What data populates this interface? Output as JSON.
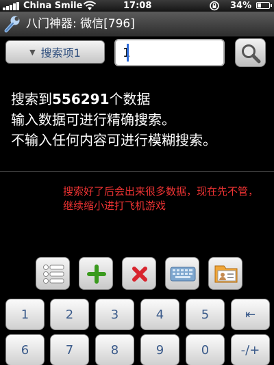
{
  "status_bar": {
    "carrier": "China Smile",
    "time": "17:08",
    "battery_percent": "34%",
    "battery_level": 0.34,
    "icons": [
      "signal-icon",
      "wifi-icon",
      "rotation-lock-icon",
      "battery-icon"
    ]
  },
  "title_bar": {
    "title": "八门神器: 微信[796]",
    "icon": "wrench-icon"
  },
  "search": {
    "type_button_label": "搜索项1",
    "input_value": "1",
    "search_icon": "search-icon"
  },
  "info": {
    "line1_prefix": "搜索到",
    "line1_count": "556291",
    "line1_suffix": "个数据",
    "line2": "输入数据可进行精确搜索。",
    "line3": "不输入任何内容可进行模糊搜索。"
  },
  "annotation": {
    "text": "搜索好了后会出来很多数据，现在先不管，继续缩小进打飞机游戏"
  },
  "toolbar": {
    "items": [
      {
        "name": "list-button",
        "icon": "list-icon"
      },
      {
        "name": "add-button",
        "icon": "plus-icon"
      },
      {
        "name": "delete-button",
        "icon": "close-icon"
      },
      {
        "name": "keyboard-button",
        "icon": "keyboard-icon"
      },
      {
        "name": "contacts-button",
        "icon": "contact-card-icon"
      }
    ],
    "colors": {
      "plus": "#3a9a1e",
      "close": "#d8252e"
    }
  },
  "keypad": {
    "row1": [
      "1",
      "2",
      "3",
      "4",
      "5",
      "⇤"
    ],
    "row2": [
      "6",
      "7",
      "8",
      "9",
      "0",
      "-/+"
    ]
  }
}
